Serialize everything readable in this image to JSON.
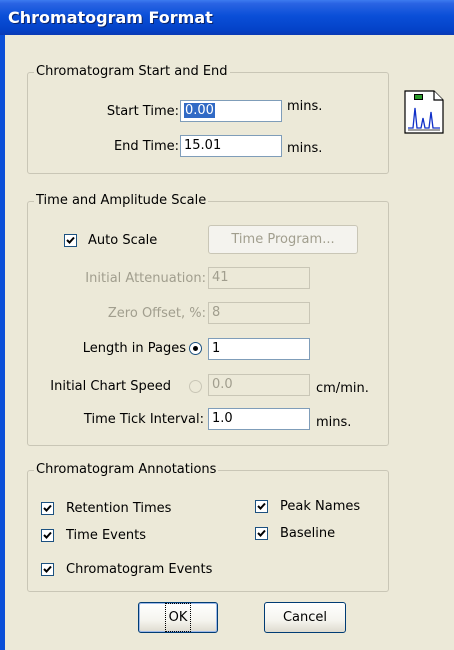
{
  "window": {
    "title": "Chromatogram Format"
  },
  "start_end": {
    "group_label": "Chromatogram Start and End",
    "start_label": "Start Time:",
    "start_value": "0.00",
    "end_label": "End Time:",
    "end_value": "15.01",
    "units": "mins."
  },
  "scale": {
    "group_label": "Time and Amplitude Scale",
    "auto_scale_label": "Auto Scale",
    "auto_scale_checked": true,
    "time_program_label": "Time Program...",
    "initial_attenuation_label": "Initial Attenuation:",
    "initial_attenuation_value": "41",
    "zero_offset_label": "Zero Offset, %:",
    "zero_offset_value": "8",
    "length_pages_label": "Length in Pages",
    "length_pages_value": "1",
    "chart_speed_label": "Initial Chart Speed",
    "chart_speed_value": "0.0",
    "chart_speed_units": "cm/min.",
    "tick_interval_label": "Time Tick Interval:",
    "tick_interval_value": "1.0",
    "tick_interval_units": "mins."
  },
  "annotations": {
    "group_label": "Chromatogram Annotations",
    "items": [
      {
        "label": "Retention Times",
        "checked": true
      },
      {
        "label": "Peak Names",
        "checked": true
      },
      {
        "label": "Time Events",
        "checked": true
      },
      {
        "label": "Baseline",
        "checked": true
      },
      {
        "label": "Chromatogram Events",
        "checked": true
      }
    ]
  },
  "buttons": {
    "ok": "OK",
    "cancel": "Cancel"
  },
  "icons": {
    "chromatogram": "chromatogram-document-icon",
    "check": "checkmark-icon"
  },
  "colors": {
    "title_bar": "#0a4fd8",
    "face": "#ece9d8",
    "selection": "#316ac5"
  }
}
